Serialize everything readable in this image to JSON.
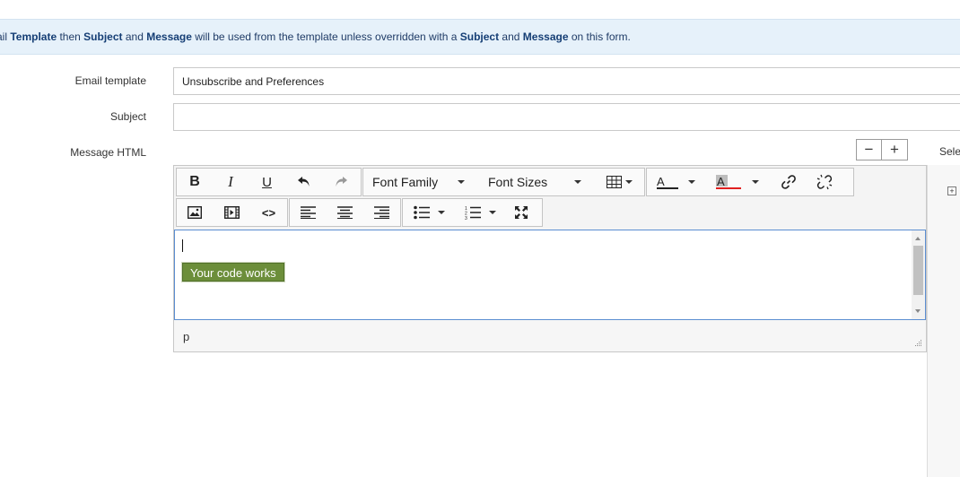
{
  "info": {
    "p1": "ail ",
    "b1": "Template",
    "p2": " then ",
    "b2": "Subject",
    "p3": " and ",
    "b3": "Message",
    "p4": " will be used from the template unless overridden with a ",
    "b4": "Subject",
    "p5": " and ",
    "b5": "Message",
    "p6": " on this form."
  },
  "form": {
    "email_template_label": "Email template",
    "email_template_value": "Unsubscribe and Preferences",
    "subject_label": "Subject",
    "subject_value": "",
    "message_label": "Message HTML"
  },
  "zoom": {
    "minus": "−",
    "plus": "+"
  },
  "side_label": "Sele",
  "toolbar": {
    "bold": "B",
    "italic": "I",
    "underline": "U",
    "font_family": "Font Family",
    "font_sizes": "Font Sizes",
    "source_code": "<>"
  },
  "editor": {
    "button_text": "Your code works",
    "status_path": "p"
  },
  "colors": {
    "info_bg": "#e6f1fa",
    "green_button": "#6c8e3a",
    "font_color_bar": "#222222",
    "bg_color_bar": "#e02020",
    "focus_border": "#5b8ed1"
  }
}
